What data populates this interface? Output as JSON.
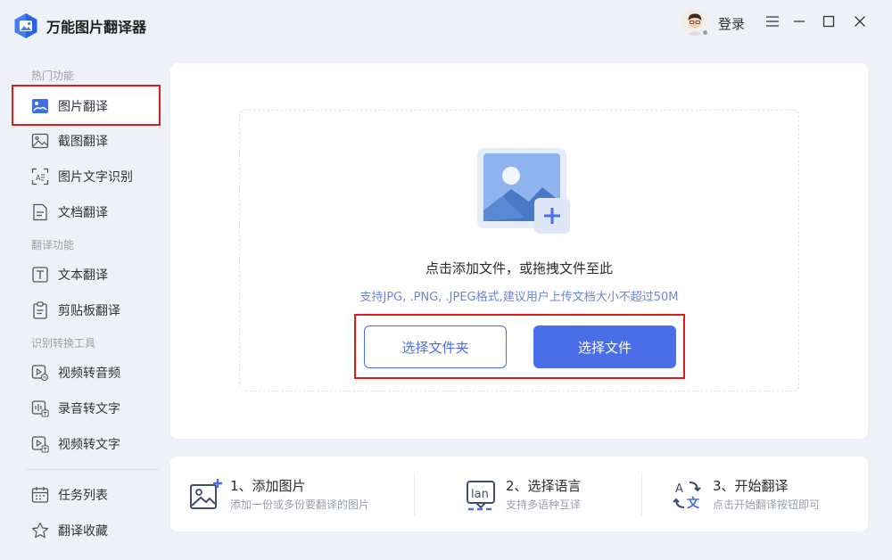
{
  "app": {
    "title": "万能图片翻译器",
    "login": "登录"
  },
  "sidebar": {
    "sections": [
      {
        "title": "热门功能"
      },
      {
        "title": "翻译功能"
      },
      {
        "title": "识别转换工具"
      }
    ],
    "items": [
      {
        "label": "图片翻译",
        "icon": "image-translate-icon",
        "active": true
      },
      {
        "label": "截图翻译",
        "icon": "screenshot-icon"
      },
      {
        "label": "图片文字识别",
        "icon": "ocr-icon"
      },
      {
        "label": "文档翻译",
        "icon": "document-icon"
      },
      {
        "label": "文本翻译",
        "icon": "text-icon"
      },
      {
        "label": "剪贴板翻译",
        "icon": "clipboard-icon"
      },
      {
        "label": "视频转音频",
        "icon": "video-audio-icon"
      },
      {
        "label": "录音转文字",
        "icon": "recording-icon"
      },
      {
        "label": "视频转文字",
        "icon": "video-text-icon"
      },
      {
        "label": "任务列表",
        "icon": "calendar-icon"
      },
      {
        "label": "翻译收藏",
        "icon": "star-icon"
      }
    ]
  },
  "upload": {
    "prompt": "点击添加文件，或拖拽文件至此",
    "hint": "支持JPG, .PNG, .JPEG格式,建议用户上传文档大小不超过50M",
    "select_folder": "选择文件夹",
    "select_file": "选择文件"
  },
  "steps": [
    {
      "title": "1、添加图片",
      "subtitle": "添加一份或多份要翻译的图片",
      "icon": "add-image-icon"
    },
    {
      "title": "2、选择语言",
      "subtitle": "支持多语种互译",
      "icon": "language-icon"
    },
    {
      "title": "3、开始翻译",
      "subtitle": "点击开始翻译按钮即可",
      "icon": "translate-icon"
    }
  ],
  "colors": {
    "accent": "#4a6ee8",
    "highlight": "#e01b1b",
    "background": "#eef1f8"
  }
}
